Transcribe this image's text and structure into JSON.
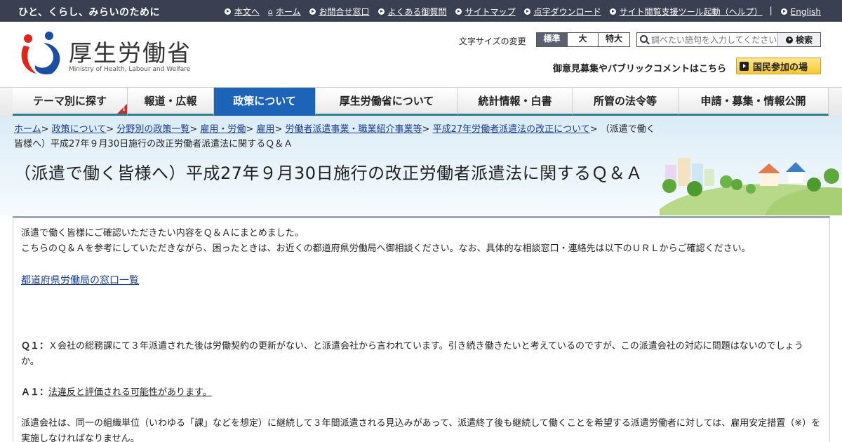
{
  "top_bar": {
    "tagline": "ひと、くらし、みらいのために",
    "links": [
      "本文へ",
      "ホーム",
      "お問合せ窓口",
      "よくある御質問",
      "サイトマップ",
      "点字ダウンロード",
      "サイト閲覧支援ツール起動（ヘルプ）",
      "English"
    ],
    "separator": "|"
  },
  "header": {
    "logo_text": "厚生労働省",
    "logo_sub": "Ministry of Health, Labour and Welfare",
    "font_size_label": "文字サイズの変更",
    "font_sizes": [
      "標準",
      "大",
      "特大"
    ],
    "search_placeholder": "調べたい語句を入力してください",
    "search_button": "検索",
    "public_comment": "御意見募集やパブリックコメントはこちら",
    "kokumin_button": "国民参加の場"
  },
  "gnav": {
    "items": [
      "テーマ別に探す",
      "報道・広報",
      "政策について",
      "厚生労働省について",
      "統計情報・白書",
      "所管の法令等",
      "申請・募集・情報公開"
    ],
    "active": "政策について"
  },
  "breadcrumb": {
    "items": [
      "ホーム",
      "政策について",
      "分野別の政策一覧",
      "雇用・労働",
      "雇用",
      "労働者派遣事業・職業紹介事業等",
      "平成27年労働者派遣法の改正について"
    ],
    "separator": ">",
    "current": "（派遣で働く皆様へ）平成27年９月30日施行の改正労働者派遣法に関するＱ＆Ａ"
  },
  "page_title": "（派遣で働く皆様へ）平成27年９月30日施行の改正労働者派遣法に関するＱ＆Ａ",
  "content": {
    "intro_line1": "派遣で働く皆様にご確認いただきたい内容をＱ＆Ａにまとめました。",
    "intro_line2": "こちらのＱ＆Ａを参考にしていただきながら、困ったときは、お近くの都道府県労働局へ御相談ください。なお、具体的な相談窓口・連絡先は以下のＵＲＬからご確認ください。",
    "link": "都道府県労働局の窓口一覧",
    "q1_label": "Ｑ１：",
    "q1_text": "Ｘ会社の総務課にて３年派遣された後は労働契約の更新がない、と派遣会社から言われています。引き続き働きたいと考えているのですが、この派遣会社の対応に問題はないのでしょうか。",
    "a1_label": "Ａ１：",
    "a1_text": "法違反と評価される可能性があります。",
    "answer_text": "派遣会社は、同一の組織単位（いわゆる「課」などを想定）に継続して３年間派遣される見込みがあって、派遣終了後も継続して働くことを希望する派遣労働者に対しては、雇用安定措置（※）を実施しなければなりません。"
  }
}
